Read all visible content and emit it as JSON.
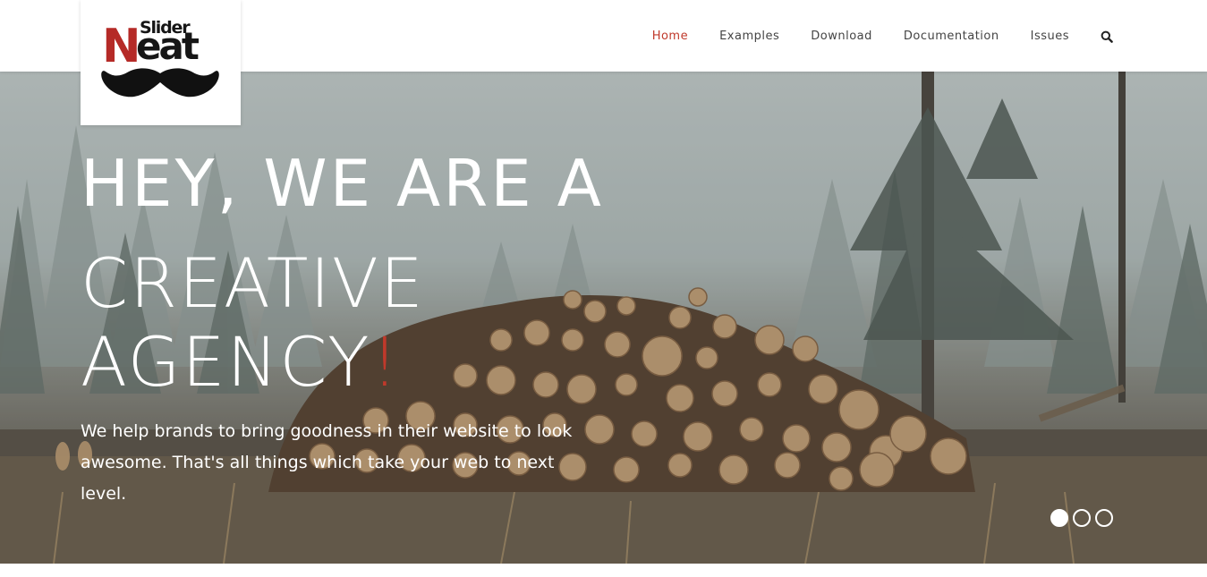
{
  "brand": {
    "top_word": "Slider",
    "main_initial": "N",
    "main_rest": "eat",
    "mark_icon": "mustache-icon"
  },
  "nav": {
    "items": [
      {
        "label": "Home",
        "active": true
      },
      {
        "label": "Examples",
        "active": false
      },
      {
        "label": "Download",
        "active": false
      },
      {
        "label": "Documentation",
        "active": false
      },
      {
        "label": "Issues",
        "active": false
      }
    ],
    "search_icon": "search-icon"
  },
  "hero": {
    "line1": "HEY, WE ARE A",
    "line2": "CREATIVE",
    "line3": "AGENCY",
    "exclaim": "!",
    "tagline": "We help brands to bring goodness in their website to look awesome. That's all things which take your web to next level.",
    "slides": {
      "total": 3,
      "active": 1
    }
  },
  "colors": {
    "accent": "#c0392b",
    "logo_red": "#b52a27",
    "nav_text": "#444444",
    "hero_text": "#ffffff"
  }
}
